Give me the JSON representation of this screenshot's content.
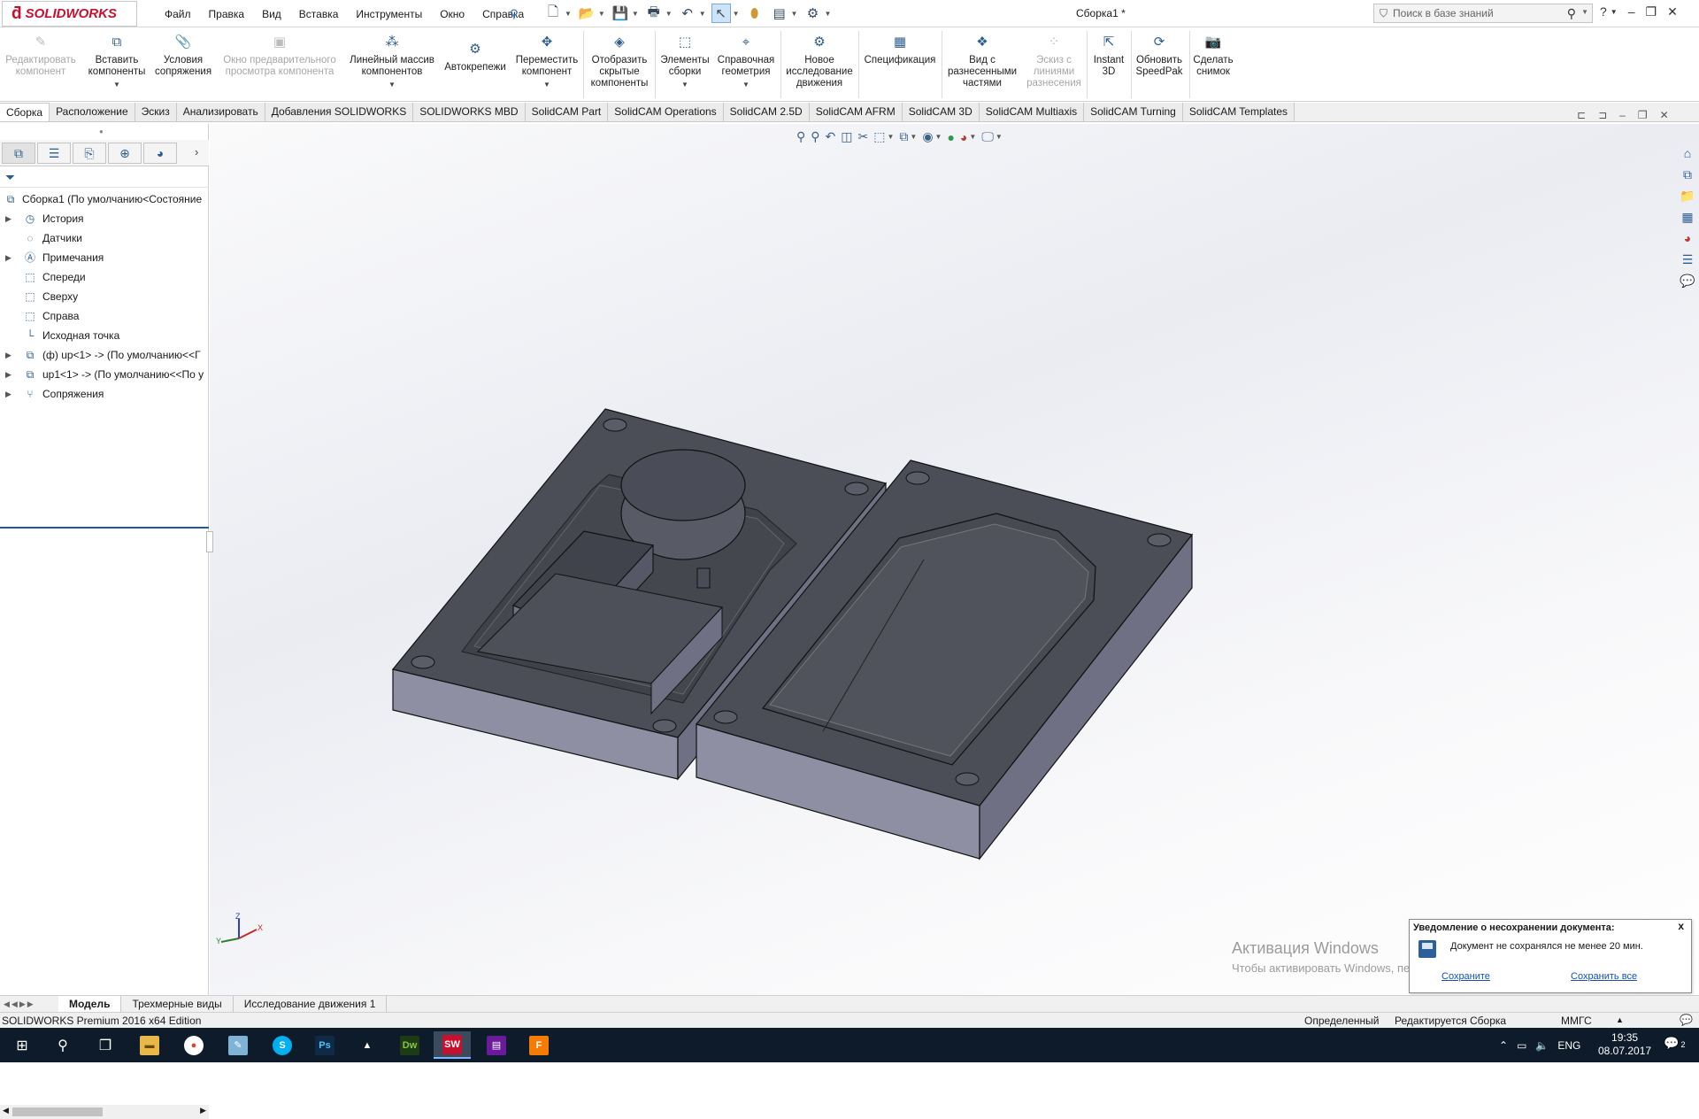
{
  "app": {
    "brand": "SOLIDWORKS",
    "document_title": "Сборка1 *",
    "menu": [
      "Файл",
      "Правка",
      "Вид",
      "Вставка",
      "Инструменты",
      "Окно",
      "Справка"
    ],
    "search_placeholder": "Поиск в базе знаний"
  },
  "ribbon": {
    "edit_component": "Редактировать компонент",
    "insert_components": "Вставить компоненты",
    "mate": "Условия сопряжения",
    "preview_window": "Окно предварительного просмотра компонента",
    "linear_pattern": "Линейный массив компонентов",
    "smart_fasteners": "Автокрепежи",
    "move_component": "Переместить компонент",
    "show_hidden": "Отобразить скрытые компоненты",
    "assembly_features": "Элементы сборки",
    "reference_geometry": "Справочная геометрия",
    "new_motion": "Новое исследование движения",
    "bom": "Спецификация",
    "exploded_view": "Вид с разнесенными частями",
    "explode_line": "Эскиз с линиями разнесения",
    "instant3d": "Instant 3D",
    "speedpak": "Обновить SpeedPak",
    "snapshot": "Сделать снимок"
  },
  "command_tabs": [
    "Сборка",
    "Расположение",
    "Эскиз",
    "Анализировать",
    "Добавления SOLIDWORKS",
    "SOLIDWORKS MBD",
    "SolidCAM Part",
    "SolidCAM Operations",
    "SolidCAM 2.5D",
    "SolidCAM AFRM",
    "SolidCAM 3D",
    "SolidCAM Multiaxis",
    "SolidCAM Turning",
    "SolidCAM Templates"
  ],
  "tree": {
    "root": "Сборка1  (По умолчанию<Состояние",
    "items": [
      "История",
      "Датчики",
      "Примечания",
      "Спереди",
      "Сверху",
      "Справа",
      "Исходная точка",
      "(ф) up<1> -> (По умолчанию<<Г",
      "up1<1> -> (По умолчанию<<По у",
      "Сопряжения"
    ]
  },
  "bottom_tabs": [
    "Модель",
    "Трехмерные виды",
    "Исследование движения 1"
  ],
  "status": {
    "edition": "SOLIDWORKS Premium 2016 x64 Edition",
    "definition": "Определенный",
    "editing": "Редактируется Сборка",
    "units": "ММГС"
  },
  "watermark": {
    "line1": "Активация Windows",
    "line2": "Чтобы активировать Windows, перейдите в раздел \"Параметры\"."
  },
  "notification": {
    "title": "Уведомление о несохранении документа:",
    "message": "Документ не сохранялся не менее 20 мин.",
    "save": "Сохраните",
    "save_all": "Сохранить все"
  },
  "taskbar": {
    "lang": "ENG",
    "time": "19:35",
    "date": "08.07.2017",
    "notification_count": "2"
  },
  "colors": {
    "brand_red": "#c8102e",
    "part_face": "#4b4d57",
    "part_side": "#8e8fa3",
    "accent_blue": "#1f5aa8"
  }
}
